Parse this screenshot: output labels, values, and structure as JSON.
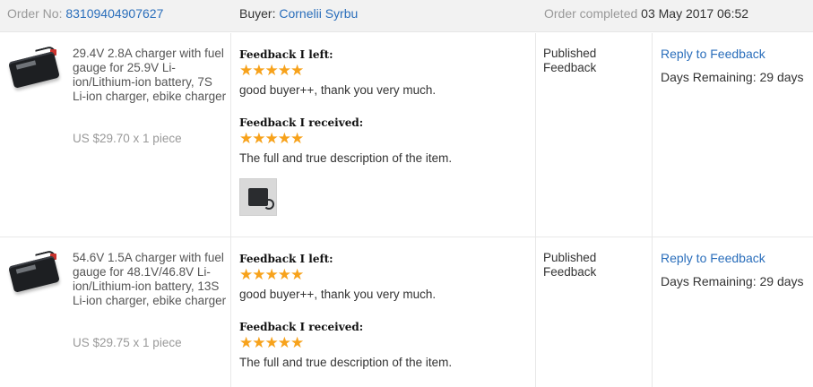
{
  "header": {
    "order_no_label": "Order No:",
    "order_no": "83109404907627",
    "buyer_label": "Buyer:",
    "buyer_name": "Cornelii Syrbu",
    "status_label": "Order completed",
    "status_date": "03 May 2017 06:52"
  },
  "items": [
    {
      "title": "29.4V 2.8A charger with fuel gauge for 25.9V Li-ion/Lithium-ion battery, 7S Li-ion charger, ebike charger",
      "price": "US $29.70 x 1 piece",
      "feedback_left_label": "Feedback I left:",
      "feedback_left_stars": 5,
      "feedback_left_text": "good buyer++, thank you very much.",
      "feedback_received_label": "Feedback I received:",
      "feedback_received_stars": 5,
      "feedback_received_text": "The full and true description of the item.",
      "status": "Published Feedback",
      "reply_label": "Reply to Feedback",
      "days_remaining": "Days Remaining: 29 days"
    },
    {
      "title": "54.6V 1.5A charger with fuel gauge for 48.1V/46.8V Li-ion/Lithium-ion battery, 13S Li-ion charger, ebike charger",
      "price": "US $29.75 x 1 piece",
      "feedback_left_label": "Feedback I left:",
      "feedback_left_stars": 5,
      "feedback_left_text": "good buyer++, thank you very much.",
      "feedback_received_label": "Feedback I received:",
      "feedback_received_stars": 5,
      "feedback_received_text": "The full and true description of the item.",
      "status": "Published Feedback",
      "reply_label": "Reply to Feedback",
      "days_remaining": "Days Remaining: 29 days"
    }
  ],
  "icons": {
    "star": "star-icon",
    "product_thumbnail": "charger-icon",
    "feedback_photo": "photo-thumbnail-icon"
  },
  "colors": {
    "link": "#2a6ebb",
    "star": "#f7a21b",
    "header_bg": "#f2f2f2",
    "muted": "#999999"
  }
}
